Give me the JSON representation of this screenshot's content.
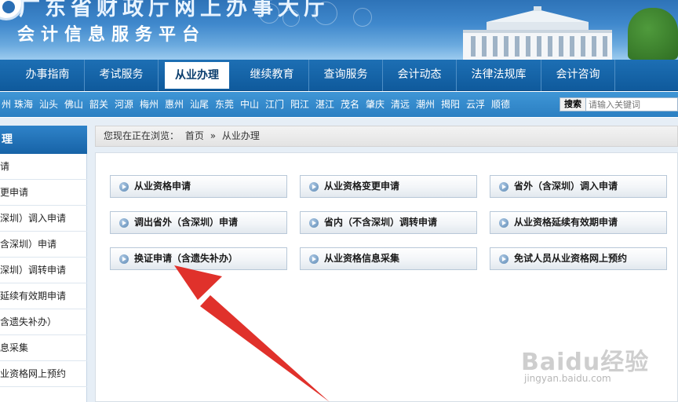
{
  "header": {
    "title_line1": "广东省财政厅网上办事大厅",
    "title_line2": "会计信息服务平台"
  },
  "nav": {
    "items": [
      {
        "label": "办事指南"
      },
      {
        "label": "考试服务"
      },
      {
        "label": "从业办理",
        "active": true
      },
      {
        "label": "继续教育"
      },
      {
        "label": "查询服务"
      },
      {
        "label": "会计动态"
      },
      {
        "label": "法律法规库"
      },
      {
        "label": "会计咨询"
      }
    ]
  },
  "cities": [
    "州",
    "珠海",
    "汕头",
    "佛山",
    "韶关",
    "河源",
    "梅州",
    "惠州",
    "汕尾",
    "东莞",
    "中山",
    "江门",
    "阳江",
    "湛江",
    "茂名",
    "肇庆",
    "清远",
    "潮州",
    "揭阳",
    "云浮",
    "顺德"
  ],
  "search": {
    "button_label": "搜索",
    "placeholder": "请输入关键词"
  },
  "sidebar": {
    "title": "理",
    "items": [
      {
        "label": "请"
      },
      {
        "label": "更申请"
      },
      {
        "label": "深圳）调入申请"
      },
      {
        "label": "含深圳）申请"
      },
      {
        "label": "深圳）调转申请"
      },
      {
        "label": "延续有效期申请"
      },
      {
        "label": "含遗失补办）"
      },
      {
        "label": "息采集"
      },
      {
        "label": "业资格网上预约"
      }
    ]
  },
  "breadcrumb": {
    "prefix": "您现在正在浏览：",
    "home": "首页",
    "separator": "»",
    "current": "从业办理"
  },
  "services": [
    {
      "label": "从业资格申请"
    },
    {
      "label": "从业资格变更申请"
    },
    {
      "label": "省外（含深圳）调入申请"
    },
    {
      "label": "调出省外（含深圳）申请"
    },
    {
      "label": "省内（不含深圳）调转申请"
    },
    {
      "label": "从业资格延续有效期申请"
    },
    {
      "label": "换证申请（含遗失补办）"
    },
    {
      "label": "从业资格信息采集"
    },
    {
      "label": "免试人员从业资格网上预约"
    }
  ],
  "watermark": {
    "logo": "Baidu经验",
    "url": "jingyan.baidu.com"
  },
  "colors": {
    "nav_bg": "#0f5a9c",
    "citybar_bg": "#2b7fc2",
    "annotation_arrow": "#e0312b"
  }
}
